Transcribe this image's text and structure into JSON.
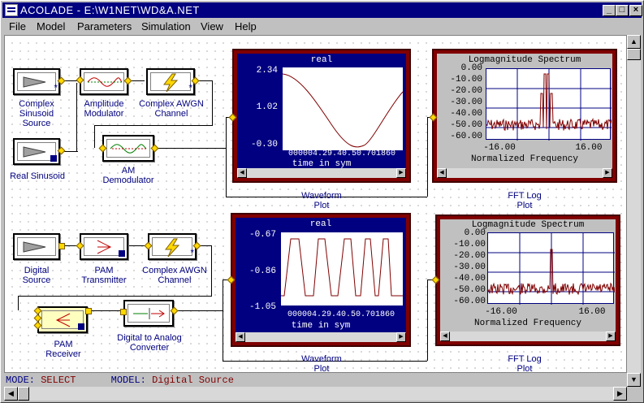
{
  "window": {
    "title": "ACOLADE - E:\\W1NET\\WD&A.NET",
    "buttons": [
      "_",
      "□",
      "×"
    ]
  },
  "menu": [
    "File",
    "Model",
    "Parameters",
    "Simulation",
    "View",
    "Help"
  ],
  "status": {
    "mode_label": "MODE:",
    "mode_value": "SELECT",
    "model_label": "MODEL:",
    "model_value": "Digital Source"
  },
  "blocks": {
    "complex_sinusoid": "Complex\nSinusoid\nSource",
    "real_sinusoid": "Real Sinusoid",
    "amplitude_modulator": "Amplitude\nModulator",
    "complex_awgn_1": "Complex AWGN\nChannel",
    "am_demodulator": "AM\nDemodulator",
    "digital_source": "Digital\nSource",
    "pam_transmitter": "PAM\nTransmitter",
    "complex_awgn_2": "Complex AWGN\nChannel",
    "pam_receiver": "PAM\nReceiver",
    "dac": "Digital to Analog\nConverter"
  },
  "captions": {
    "waveform": "Waveform\nPlot",
    "fft": "FFT Log\nPlot"
  },
  "plots": {
    "wave1": {
      "title": "real",
      "xlabel": "time in sym",
      "yticks": [
        "2.34",
        "1.02",
        "-0.30"
      ],
      "xticks": "000004.29.40.50.701860"
    },
    "fft1": {
      "title": "Logmagnitude Spectrum",
      "xlabel": "Normalized Frequency",
      "yticks": [
        "0.00",
        "-10.00",
        "-20.00",
        "-30.00",
        "-40.00",
        "-50.00",
        "-60.00"
      ],
      "xticks": [
        "-16.00",
        "16.00"
      ]
    },
    "wave2": {
      "title": "real",
      "xlabel": "time in sym",
      "yticks": [
        "-0.67",
        "-0.86",
        "-1.05"
      ],
      "xticks": "000004.29.40.50.701860"
    },
    "fft2": {
      "title": "Logmagnitude Spectrum",
      "xlabel": "Normalized Frequency",
      "yticks": [
        "0.00",
        "-10.00",
        "-20.00",
        "-30.00",
        "-40.00",
        "-50.00",
        "-60.00"
      ],
      "xticks": [
        "-16.00",
        "16.00"
      ]
    }
  },
  "colors": {
    "accent": "#000080",
    "trace": "#800000",
    "port": "#ffd800"
  }
}
